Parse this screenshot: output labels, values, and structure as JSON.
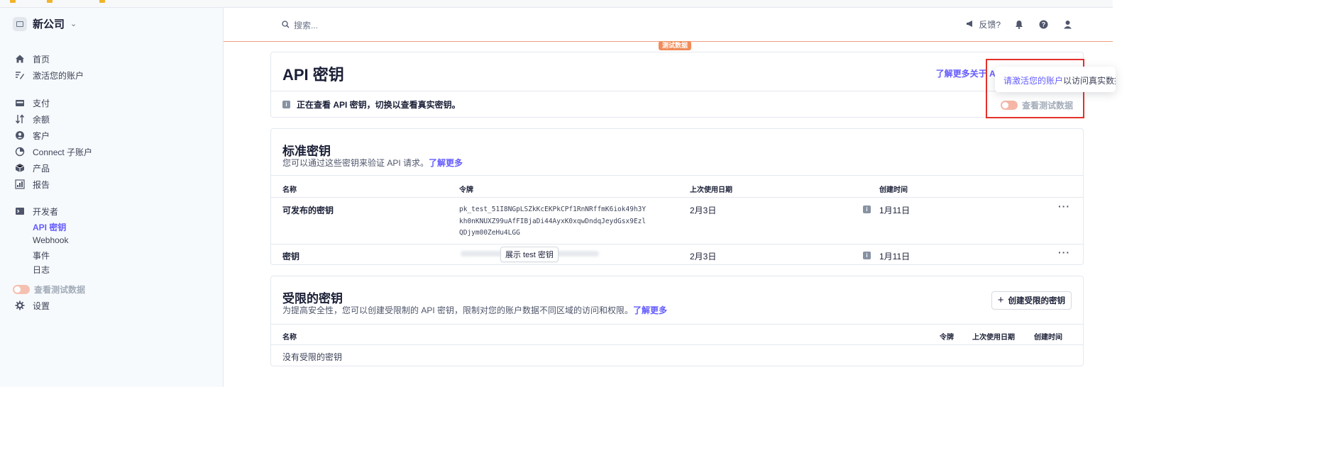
{
  "company": {
    "name": "新公司"
  },
  "search": {
    "placeholder": "搜索..."
  },
  "header": {
    "feedback": "反馈?"
  },
  "test_badge": "测试数据",
  "sidebar": {
    "items": [
      {
        "label": "首页",
        "icon": "home-icon"
      },
      {
        "label": "激活您的账户",
        "icon": "edit-icon"
      },
      {
        "label": "支付",
        "icon": "wallet-icon"
      },
      {
        "label": "余额",
        "icon": "transfer-icon"
      },
      {
        "label": "客户",
        "icon": "customer-icon"
      },
      {
        "label": "Connect 子账户",
        "icon": "connect-icon"
      },
      {
        "label": "产品",
        "icon": "box-icon"
      },
      {
        "label": "报告",
        "icon": "chart-icon"
      },
      {
        "label": "开发者",
        "icon": "terminal-icon"
      }
    ],
    "dev_subitems": [
      "API 密钥",
      "Webhook",
      "事件",
      "日志"
    ],
    "view_test_data": "查看测试数据",
    "settings": "设置"
  },
  "api_page": {
    "title": "API 密钥",
    "learn_more": "了解更多关于 AI",
    "info": "正在查看 API 密钥，切换以查看真实密钥。",
    "view_test_data": "查看测试数据"
  },
  "tooltip": {
    "link": "请激活您的账户",
    "rest": "以访问真实数据"
  },
  "standard_keys": {
    "title": "标准密钥",
    "subtitle": "您可以通过这些密钥来验证 API 请求。",
    "learn_more": "了解更多",
    "columns": [
      "名称",
      "令牌",
      "上次使用日期",
      "创建时间"
    ],
    "rows": [
      {
        "name": "可发布的密钥",
        "token_lines": [
          "pk_test_51I8NGpLSZkKcEKPkCPf1RnNRffmK6iok49h3Y",
          "kh0nKNUXZ99uAfFIBjaDi44AyxK0xqwDndqJeydGsx9Ezl",
          "QDjym00ZeHu4LGG"
        ],
        "last_used": "2月3日",
        "created": "1月11日"
      },
      {
        "name": "密钥",
        "reveal_label": "展示 test 密钥",
        "last_used": "2月3日",
        "created": "1月11日"
      }
    ]
  },
  "restricted_keys": {
    "title": "受限的密钥",
    "subtitle": "为提高安全性，您可以创建受限制的 API 密钥，限制对您的账户数据不同区域的访问和权限。",
    "learn_more": "了解更多",
    "create_button": "创建受限的密钥",
    "columns": [
      "名称",
      "令牌",
      "上次使用日期",
      "创建时间"
    ],
    "empty": "没有受限的密钥"
  },
  "colors": {
    "accent": "#635bff",
    "test_orange": "#f08c5a",
    "highlight_red": "#e4312b"
  }
}
